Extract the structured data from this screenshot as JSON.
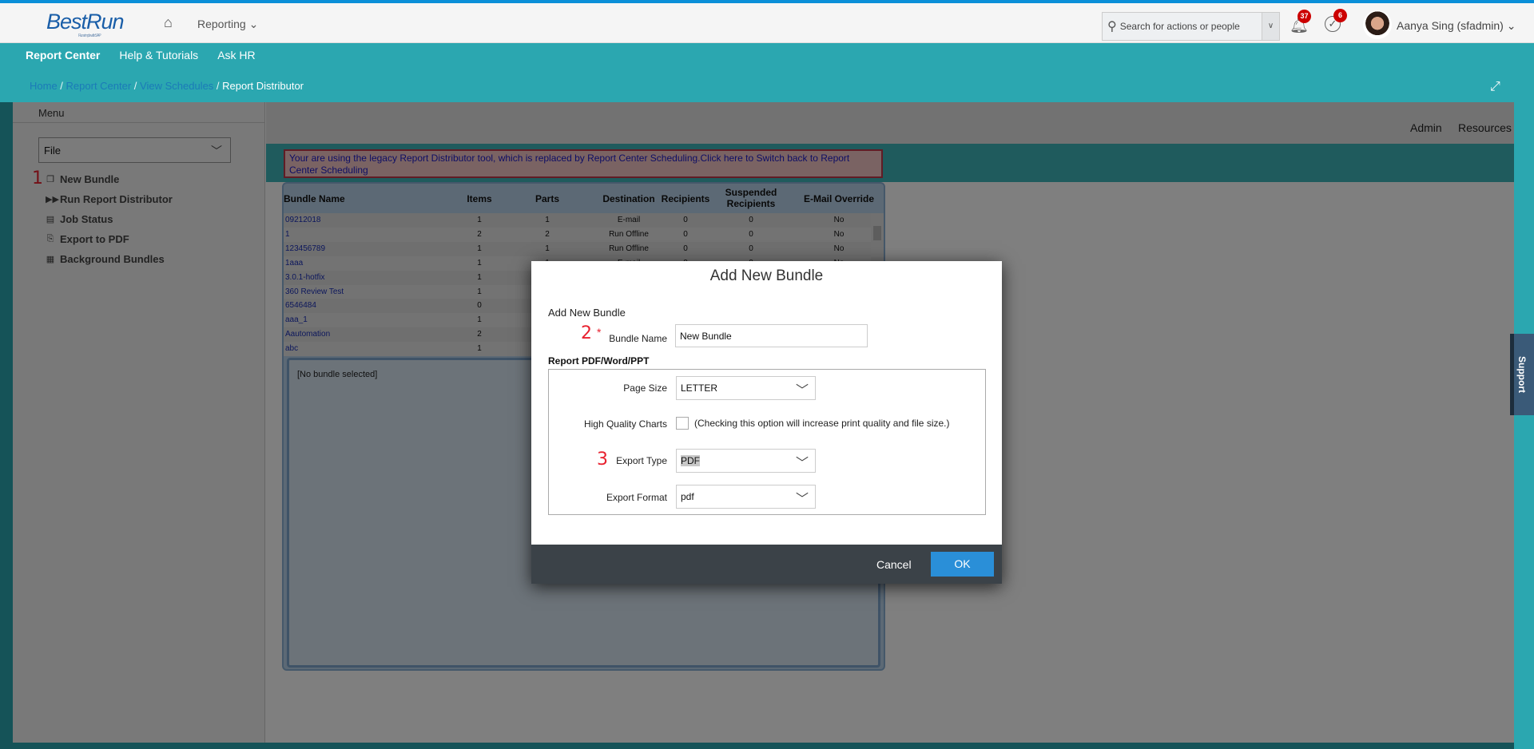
{
  "header": {
    "logo": "BestRun",
    "logo_tagline": "Run simple with SAP",
    "module": "Reporting",
    "search_placeholder": "Search for actions or people",
    "notifications_count": "37",
    "todo_count": "6",
    "user": "Aanya Sing (sfadmin)"
  },
  "subnav": [
    "Report Center",
    "Help & Tutorials",
    "Ask HR"
  ],
  "breadcrumb": {
    "items": [
      "Home",
      "Report Center",
      "View Schedules"
    ],
    "current": "Report Distributor"
  },
  "sidebar": {
    "title": "Menu",
    "file_select": "File",
    "items": [
      {
        "label": "New Bundle",
        "icon": "new-bundle-icon"
      },
      {
        "label": "Run Report Distributor",
        "icon": "run-icon"
      },
      {
        "label": "Job Status",
        "icon": "job-status-icon"
      },
      {
        "label": "Export to PDF",
        "icon": "pdf-icon"
      },
      {
        "label": "Background Bundles",
        "icon": "grid-icon"
      }
    ],
    "step": "1"
  },
  "topbar": {
    "admin": "Admin",
    "resources": "Resources"
  },
  "warning": "Your are using the legacy Report Distributor tool, which is replaced by Report Center Scheduling.Click here to Switch back to Report Center Scheduling",
  "table": {
    "columns": [
      "Bundle Name",
      "Items",
      "Parts",
      "Destination",
      "Recipients",
      "Suspended Recipients",
      "E-Mail Override"
    ],
    "rows": [
      [
        "09212018",
        "1",
        "1",
        "E-mail",
        "0",
        "0",
        "No"
      ],
      [
        "1",
        "2",
        "2",
        "Run Offline",
        "0",
        "0",
        "No"
      ],
      [
        "123456789",
        "1",
        "1",
        "Run Offline",
        "0",
        "0",
        "No"
      ],
      [
        "1aaa",
        "1",
        "1",
        "E-mail",
        "0",
        "0",
        "No"
      ],
      [
        "3.0.1-hotfix",
        "1",
        "",
        "",
        "",
        "",
        ""
      ],
      [
        "360 Review Test",
        "1",
        "",
        "",
        "",
        "",
        ""
      ],
      [
        "6546484",
        "0",
        "",
        "",
        "",
        "",
        ""
      ],
      [
        "aaa_1",
        "1",
        "",
        "",
        "",
        "",
        ""
      ],
      [
        "Aautomation",
        "2",
        "",
        "",
        "",
        "",
        ""
      ],
      [
        "abc",
        "1",
        "",
        "",
        "",
        "",
        ""
      ]
    ],
    "detail": "[No bundle selected]"
  },
  "support": "Support",
  "modal": {
    "title": "Add New Bundle",
    "section": "Add New Bundle",
    "bundle_name_label": "Bundle Name",
    "bundle_name_value": "New Bundle",
    "required": "*",
    "step2": "2",
    "group_label": "Report PDF/Word/PPT",
    "page_size_label": "Page Size",
    "page_size": "LETTER",
    "hq_label": "High Quality Charts",
    "hq_note": "(Checking this option will increase print quality and file size.)",
    "hq_checked": false,
    "export_type_label": "Export Type",
    "export_type": "PDF",
    "step3": "3",
    "export_format_label": "Export Format",
    "export_format": "pdf",
    "cancel": "Cancel",
    "ok": "OK"
  }
}
